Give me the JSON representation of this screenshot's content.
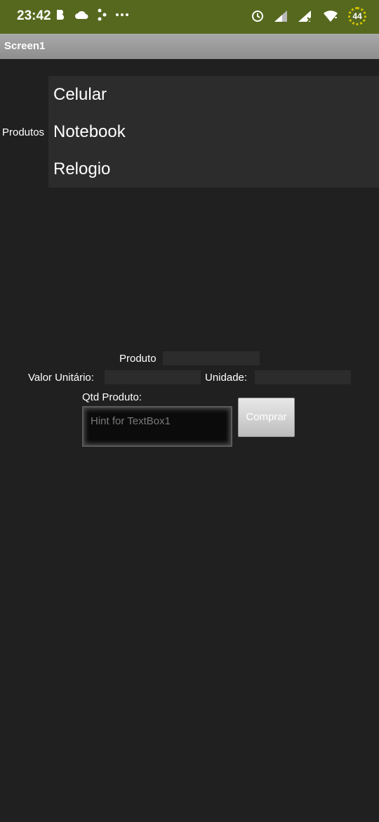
{
  "status_bar": {
    "time": "23:42",
    "left_icons": [
      "b-app-icon",
      "cloud-icon",
      "share-icon",
      "more-dots-icon"
    ],
    "right_icons": [
      "alarm-icon",
      "signal-icon",
      "signal-x-icon",
      "wifi-icon"
    ],
    "battery": "44"
  },
  "title_bar": {
    "title": "Screen1"
  },
  "produtos_label": "Produtos",
  "products": [
    {
      "label": "Celular"
    },
    {
      "label": "Notebook"
    },
    {
      "label": "Relogio"
    }
  ],
  "form": {
    "produto_label": "Produto",
    "valor_unitario_label": "Valor Unitário:",
    "unidade_label": "Unidade:",
    "qtd_label": "Qtd Produto:",
    "qtd_placeholder": "Hint for TextBox1",
    "buy_button": "Comprar"
  },
  "colors": {
    "status_bar": "#56681e",
    "background": "#202020",
    "list_background": "#2c2c2c"
  }
}
